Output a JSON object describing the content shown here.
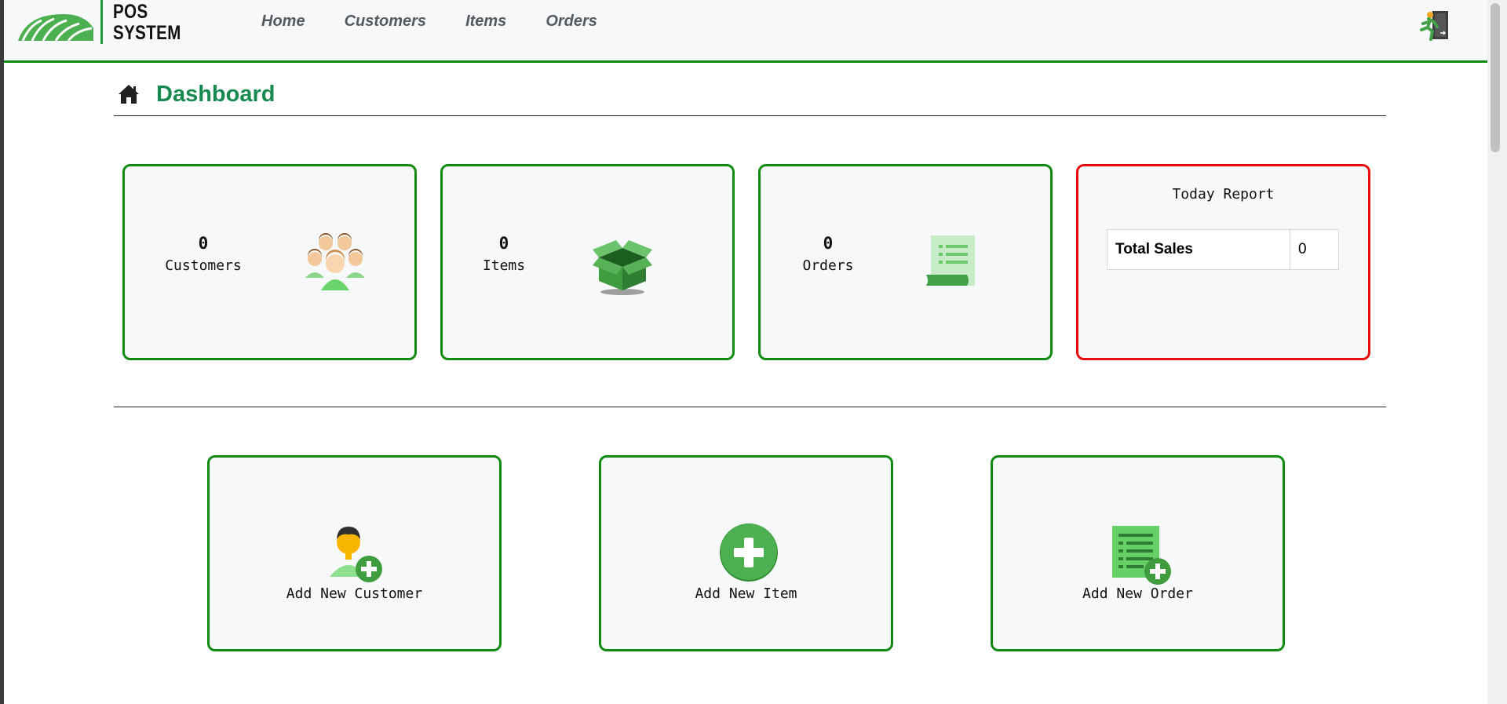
{
  "brand": {
    "line1": "POS",
    "line2": "SYSTEM"
  },
  "nav": [
    {
      "label": "Home"
    },
    {
      "label": "Customers"
    },
    {
      "label": "Items"
    },
    {
      "label": "Orders"
    }
  ],
  "header": {
    "title": "Dashboard"
  },
  "stats": {
    "customers": {
      "count": "0",
      "label": "Customers"
    },
    "items": {
      "count": "0",
      "label": "Items"
    },
    "orders": {
      "count": "0",
      "label": "Orders"
    }
  },
  "report": {
    "title": "Today Report",
    "total_sales_label": "Total Sales",
    "total_sales_value": "0"
  },
  "actions": {
    "add_customer": "Add New Customer",
    "add_item": "Add New Item",
    "add_order": "Add New Order"
  },
  "colors": {
    "accent_green": "#108a10",
    "title_green": "#188a50",
    "alert_red": "#e60e0e"
  },
  "icons": {
    "logo": "green-field-logo-icon",
    "logout": "exit-door-icon",
    "home": "home-icon",
    "customers": "people-group-icon",
    "items": "open-box-icon",
    "orders": "receipt-scroll-icon",
    "add_customer": "add-user-icon",
    "add_item": "plus-circle-icon",
    "add_order": "add-document-icon"
  }
}
